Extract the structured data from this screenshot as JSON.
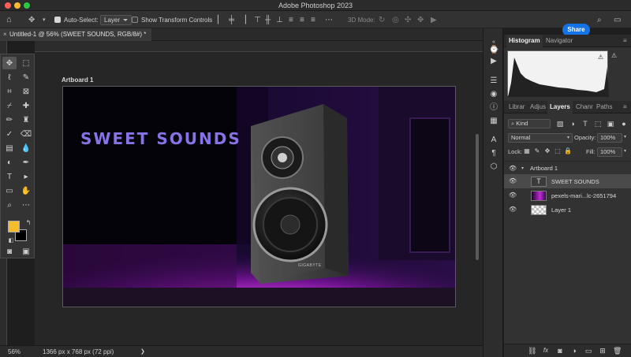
{
  "app": {
    "title": "Adobe Photoshop 2023"
  },
  "options_bar": {
    "auto_select_label": "Auto-Select:",
    "auto_select_checked": true,
    "auto_select_target": "Layer",
    "transform_controls_label": "Show Transform Controls",
    "transform_controls_checked": false,
    "mode_3d_label": "3D Mode:",
    "share_label": "Share"
  },
  "document": {
    "tab_title": "Untitled-1 @ 56% (SWEET SOUNDS, RGB/8#) *",
    "artboard_label": "Artboard 1",
    "artwork_text": "SWEET SOUNDS",
    "speaker_brand": "GIGABYTE"
  },
  "status": {
    "zoom": "56%",
    "doc_info": "1366 px x 768 px (72 ppi)"
  },
  "colors": {
    "foreground": "#f5bd29",
    "background": "#000000",
    "accent": "#1473e6",
    "artwork_text": "#8872e8"
  },
  "histogram_panel": {
    "tabs": [
      "Histogram",
      "Navigator"
    ]
  },
  "layers_panel": {
    "tabs": [
      "Librar",
      "Adjus",
      "Layers",
      "Chanr",
      "Paths"
    ],
    "filter_kind": "Kind",
    "blend_mode": "Normal",
    "opacity_label": "Opacity:",
    "opacity_value": "100%",
    "lock_label": "Lock:",
    "fill_label": "Fill:",
    "fill_value": "100%",
    "layers": [
      {
        "name": "Artboard 1",
        "type": "artboard"
      },
      {
        "name": "SWEET SOUNDS",
        "type": "text"
      },
      {
        "name": "pexels-mari...lc-2651794",
        "type": "image"
      },
      {
        "name": "Layer 1",
        "type": "empty"
      }
    ]
  }
}
